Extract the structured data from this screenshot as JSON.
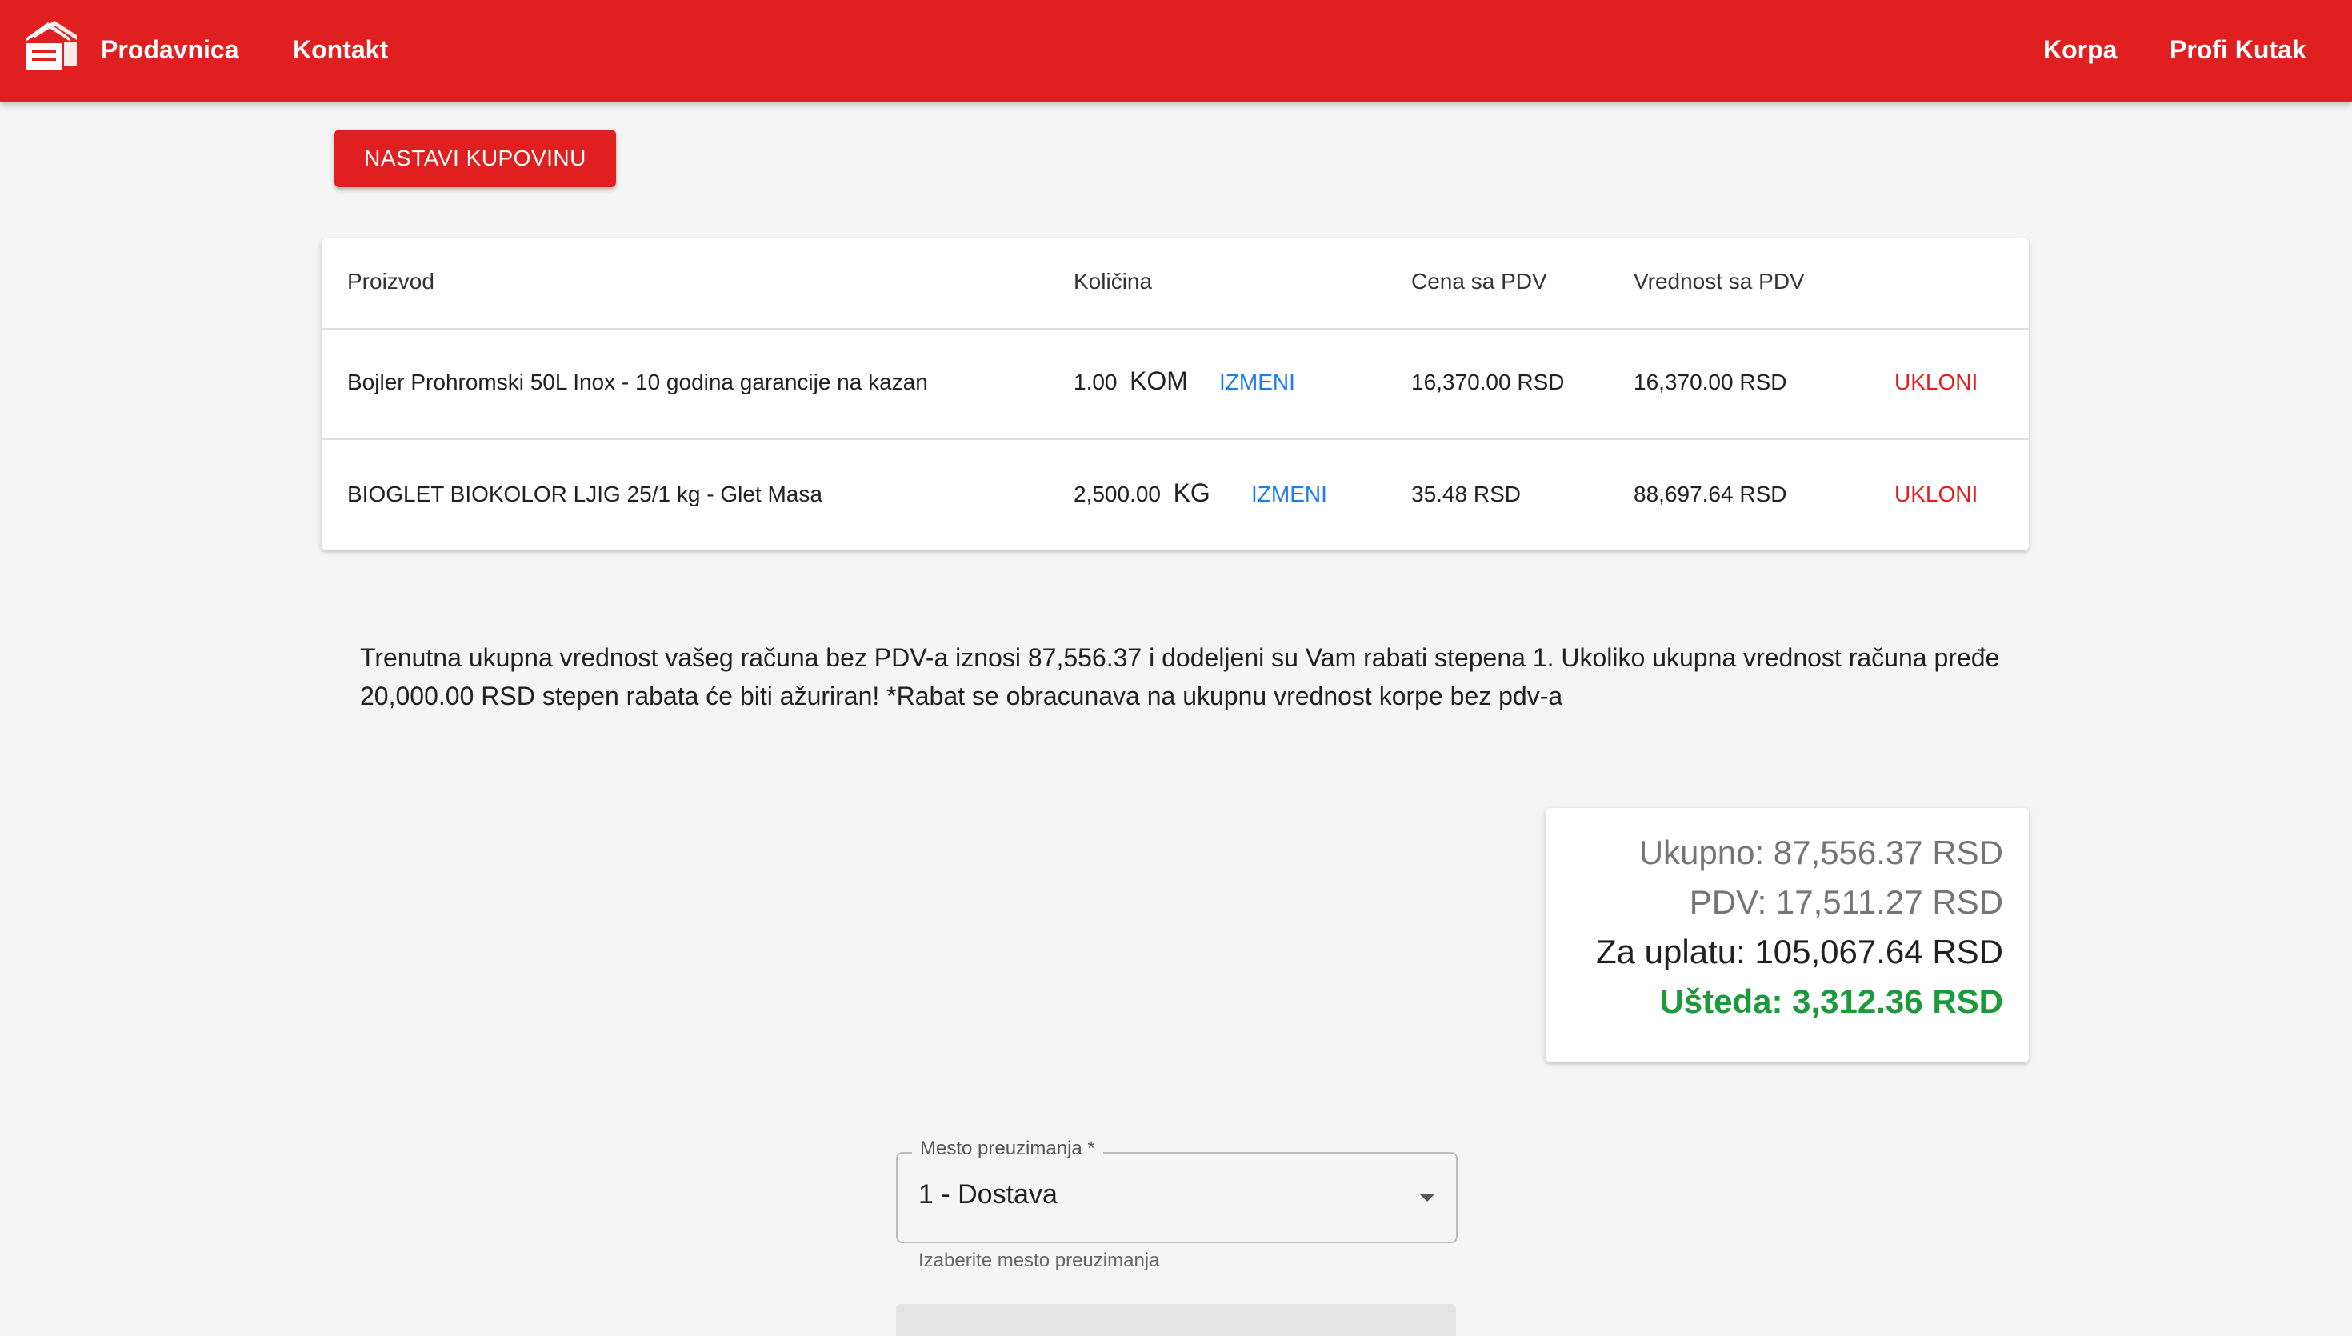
{
  "header": {
    "logo_icon": "house-stack-icon",
    "nav_left": [
      "Prodavnica",
      "Kontakt"
    ],
    "nav_right": [
      "Korpa",
      "Profi Kutak"
    ]
  },
  "continue_button": "NASTAVI KUPOVINU",
  "cart": {
    "columns": [
      "Proizvod",
      "Količina",
      "Cena sa PDV",
      "Vrednost sa PDV"
    ],
    "items": [
      {
        "product": "Bojler Prohromski 50L Inox - 10 godina garancije na kazan",
        "quantity": "1.00",
        "unit": "KOM",
        "edit": "IZMENI",
        "price": "16,370.00 RSD",
        "value": "16,370.00 RSD",
        "remove": "UKLONI"
      },
      {
        "product": "BIOGLET BIOKOLOR LJIG 25/1 kg - Glet Masa",
        "quantity": "2,500.00",
        "unit": "KG",
        "edit": "IZMENI",
        "price": "35.48 RSD",
        "value": "88,697.64 RSD",
        "remove": "UKLONI"
      }
    ]
  },
  "info_text": "Trenutna ukupna vrednost vašeg računa bez PDV-a iznosi 87,556.37 i dodeljeni su Vam rabati stepena 1. Ukoliko ukupna vrednost računa pređe 20,000.00 RSD stepen rabata će biti ažuriran! *Rabat se obracunava na ukupnu vrednost korpe bez pdv-a",
  "totals": {
    "total": "Ukupno: 87,556.37 RSD",
    "vat": "PDV: 17,511.27 RSD",
    "to_pay": "Za uplatu: 105,067.64 RSD",
    "savings": "Ušteda: 3,312.36 RSD"
  },
  "pickup": {
    "label": "Mesto preuzimanja *",
    "value": "1 - Dostava",
    "helper": "Izaberite mesto preuzimanja"
  },
  "colors": {
    "brand_red": "#e02020",
    "link_blue": "#1e7ee8",
    "savings_green": "#1a9a3a"
  }
}
